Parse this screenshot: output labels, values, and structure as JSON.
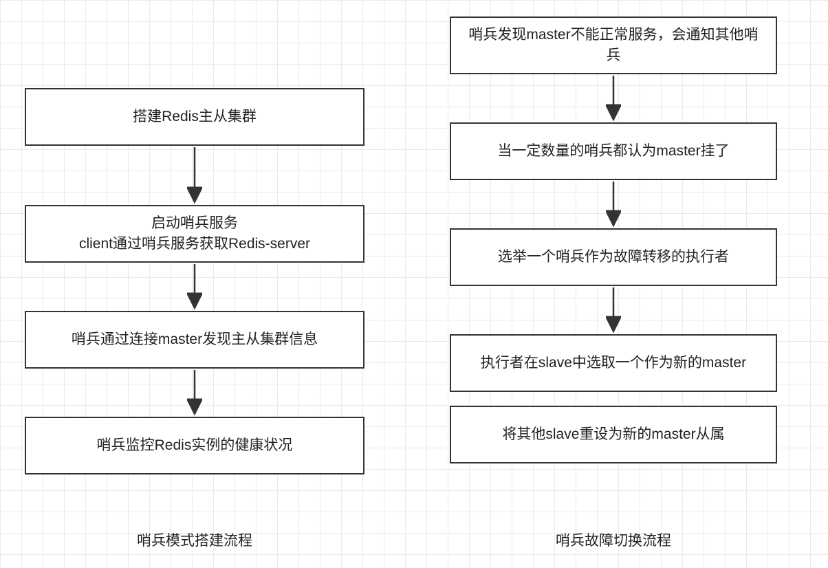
{
  "left": {
    "caption": "哨兵模式搭建流程",
    "steps": [
      "搭建Redis主从集群",
      "启动哨兵服务\nclient通过哨兵服务获取Redis-server",
      "哨兵通过连接master发现主从集群信息",
      "哨兵监控Redis实例的健康状况"
    ]
  },
  "right": {
    "caption": "哨兵故障切换流程",
    "steps": [
      "哨兵发现master不能正常服务，会通知其他哨兵",
      "当一定数量的哨兵都认为master挂了",
      "选举一个哨兵作为故障转移的执行者",
      "执行者在slave中选取一个作为新的master",
      "将其他slave重设为新的master从属"
    ]
  }
}
